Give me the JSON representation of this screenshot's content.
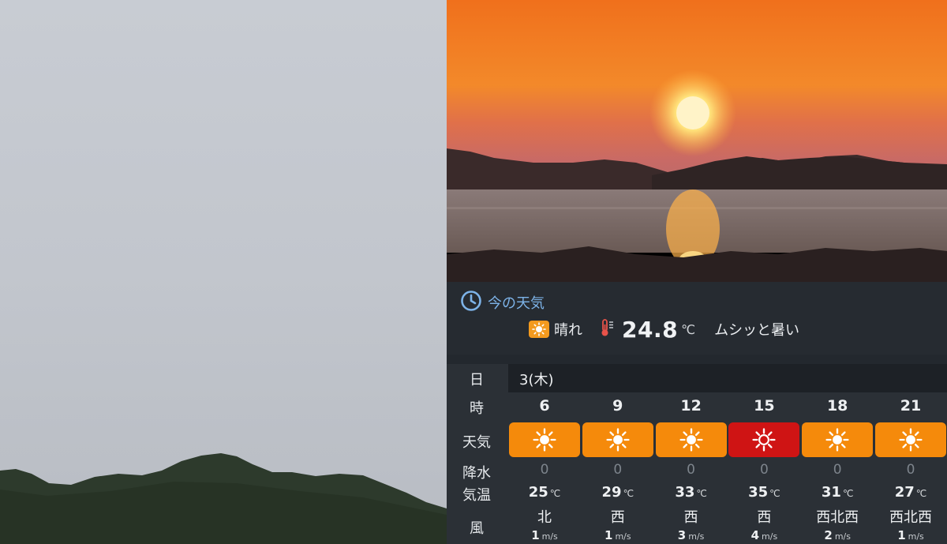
{
  "now": {
    "title": "今の天気",
    "condition": "晴れ",
    "temperature": "24.8",
    "temp_unit": "℃",
    "feels": "ムシッと暑い"
  },
  "table": {
    "labels": {
      "day": "日",
      "hour": "時",
      "weather": "天気",
      "precip": "降水",
      "temp": "気温",
      "wind": "風"
    },
    "date": "3(木)",
    "temp_unit": "℃",
    "wind_unit": "m/s",
    "columns": [
      {
        "hour": "6",
        "weather": "sunny",
        "precip": "0",
        "temp": "25",
        "wind_dir": "北",
        "wind_speed": "1"
      },
      {
        "hour": "9",
        "weather": "sunny",
        "precip": "0",
        "temp": "29",
        "wind_dir": "西",
        "wind_speed": "1"
      },
      {
        "hour": "12",
        "weather": "sunny",
        "precip": "0",
        "temp": "33",
        "wind_dir": "西",
        "wind_speed": "3"
      },
      {
        "hour": "15",
        "weather": "hot",
        "precip": "0",
        "temp": "35",
        "wind_dir": "西",
        "wind_speed": "4"
      },
      {
        "hour": "18",
        "weather": "sunny",
        "precip": "0",
        "temp": "31",
        "wind_dir": "西北西",
        "wind_speed": "2"
      },
      {
        "hour": "21",
        "weather": "sunny",
        "precip": "0",
        "temp": "27",
        "wind_dir": "西北西",
        "wind_speed": "1"
      }
    ]
  },
  "colors": {
    "sunny": "#f58a0b",
    "hot": "#cf1414",
    "accent": "#7db3e8"
  },
  "icons": {
    "clock": "clock-icon",
    "sun": "sun-icon",
    "thermometer": "thermometer-icon"
  }
}
